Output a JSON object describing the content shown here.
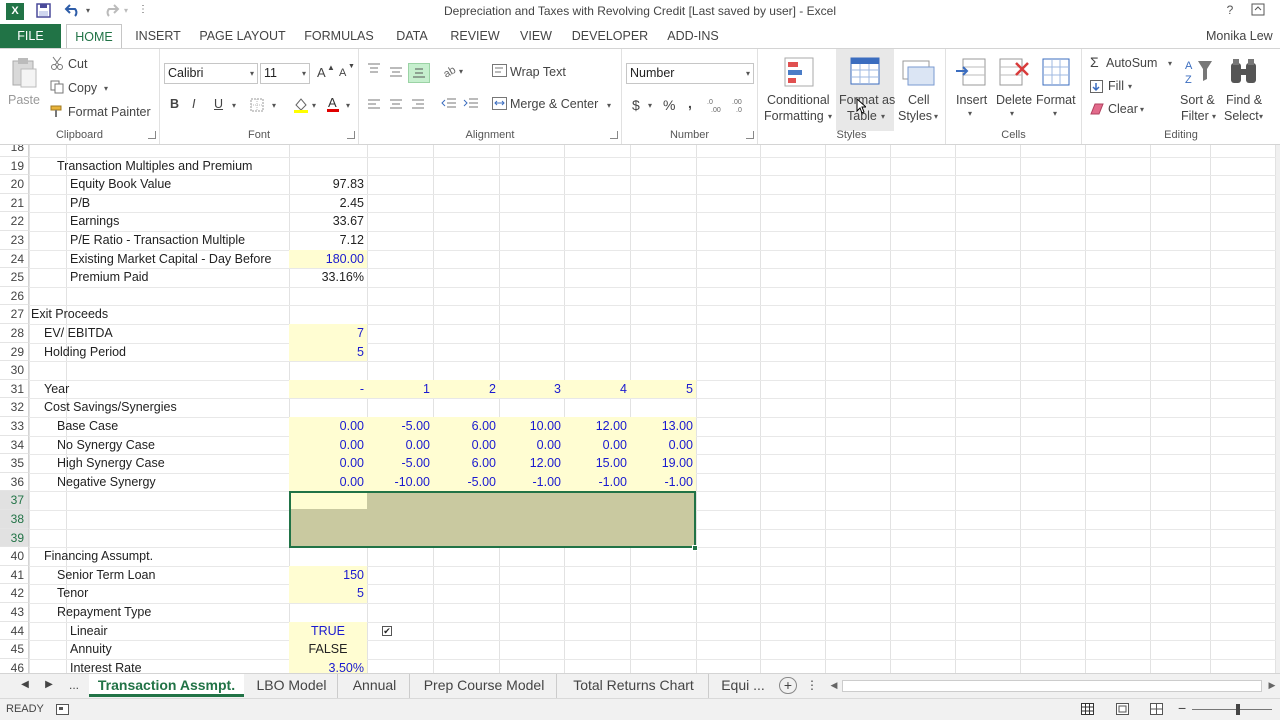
{
  "window": {
    "title": "Depreciation and Taxes with Revolving Credit [Last saved by user] - Excel",
    "help": "?",
    "user": "Monika Lew"
  },
  "ribbon_tabs": [
    "FILE",
    "HOME",
    "INSERT",
    "PAGE LAYOUT",
    "FORMULAS",
    "DATA",
    "REVIEW",
    "VIEW",
    "DEVELOPER",
    "ADD-INS"
  ],
  "clipboard": {
    "paste": "Paste",
    "cut": "Cut",
    "copy": "Copy",
    "format_painter": "Format Painter",
    "label": "Clipboard"
  },
  "font": {
    "name": "Calibri",
    "size": "11",
    "label": "Font",
    "bold": "B",
    "italic": "I",
    "underline": "U",
    "grow": "A",
    "shrink": "A"
  },
  "alignment": {
    "wrap": "Wrap Text",
    "merge": "Merge & Center",
    "label": "Alignment"
  },
  "number": {
    "format": "Number",
    "currency": "$",
    "percent": "%",
    "comma": ",",
    "label": "Number"
  },
  "styles": {
    "conditional_1": "Conditional",
    "conditional_2": "Formatting",
    "table_1": "Format as",
    "table_2": "Table",
    "cell_1": "Cell",
    "cell_2": "Styles",
    "label": "Styles"
  },
  "cells": {
    "insert": "Insert",
    "delete": "Delete",
    "format": "Format",
    "label": "Cells"
  },
  "editing": {
    "autosum": "AutoSum",
    "fill": "Fill",
    "clear": "Clear",
    "sort_1": "Sort &",
    "sort_2": "Filter",
    "find_1": "Find &",
    "find_2": "Select",
    "label": "Editing"
  },
  "rows": [
    {
      "n": "18",
      "a": "",
      "b": "",
      "c": "",
      "v": [
        "",
        "",
        "",
        "",
        "",
        ""
      ]
    },
    {
      "n": "19",
      "a": "",
      "b": "",
      "c": "Transaction Multiples and Premium",
      "v": [
        "",
        "",
        "",
        "",
        "",
        ""
      ]
    },
    {
      "n": "20",
      "a": "",
      "b": "",
      "c": "",
      "d": "Equity Book Value",
      "v": [
        "97.83",
        "",
        "",
        "",
        "",
        ""
      ]
    },
    {
      "n": "21",
      "d": "P/B",
      "v": [
        "2.45",
        "",
        "",
        "",
        "",
        ""
      ]
    },
    {
      "n": "22",
      "d": "Earnings",
      "v": [
        "33.67",
        "",
        "",
        "",
        "",
        ""
      ]
    },
    {
      "n": "23",
      "d": "P/E Ratio - Transaction Multiple",
      "v": [
        "7.12",
        "",
        "",
        "",
        "",
        ""
      ]
    },
    {
      "n": "24",
      "d": "Existing Market Capital - Day Before",
      "v": [
        "180.00",
        "",
        "",
        "",
        "",
        ""
      ]
    },
    {
      "n": "25",
      "d": "Premium Paid",
      "v": [
        "33.16%",
        "",
        "",
        "",
        "",
        ""
      ]
    },
    {
      "n": "26",
      "v": [
        "",
        "",
        "",
        "",
        "",
        ""
      ]
    },
    {
      "n": "27",
      "a": "Exit Proceeds",
      "v": [
        "",
        "",
        "",
        "",
        "",
        ""
      ]
    },
    {
      "n": "28",
      "b": "EV/ EBITDA",
      "v": [
        "7",
        "",
        "",
        "",
        "",
        ""
      ]
    },
    {
      "n": "29",
      "b": "Holding Period",
      "v": [
        "5",
        "",
        "",
        "",
        "",
        ""
      ]
    },
    {
      "n": "30",
      "v": [
        "",
        "",
        "",
        "",
        "",
        ""
      ]
    },
    {
      "n": "31",
      "b": "Year",
      "v": [
        "-",
        "1",
        "2",
        "3",
        "4",
        "5"
      ]
    },
    {
      "n": "32",
      "b": "Cost Savings/Synergies",
      "v": [
        "",
        "",
        "",
        "",
        "",
        ""
      ]
    },
    {
      "n": "33",
      "c": "Base Case",
      "v": [
        "0.00",
        "-5.00",
        "6.00",
        "10.00",
        "12.00",
        "13.00"
      ]
    },
    {
      "n": "34",
      "c": "No Synergy Case",
      "v": [
        "0.00",
        "0.00",
        "0.00",
        "0.00",
        "0.00",
        "0.00"
      ]
    },
    {
      "n": "35",
      "c": "High Synergy Case",
      "v": [
        "0.00",
        "-5.00",
        "6.00",
        "12.00",
        "15.00",
        "19.00"
      ]
    },
    {
      "n": "36",
      "c": "Negative Synergy",
      "v": [
        "0.00",
        "-10.00",
        "-5.00",
        "-1.00",
        "-1.00",
        "-1.00"
      ]
    },
    {
      "n": "37",
      "v": [
        "",
        "",
        "",
        "",
        "",
        ""
      ]
    },
    {
      "n": "38",
      "v": [
        "",
        "",
        "",
        "",
        "",
        ""
      ]
    },
    {
      "n": "39",
      "v": [
        "",
        "",
        "",
        "",
        "",
        ""
      ]
    },
    {
      "n": "40",
      "b": "Financing Assumpt.",
      "v": [
        "",
        "",
        "",
        "",
        "",
        ""
      ]
    },
    {
      "n": "41",
      "c": "Senior Term Loan",
      "v": [
        "150",
        "",
        "",
        "",
        "",
        ""
      ]
    },
    {
      "n": "42",
      "c": "Tenor",
      "v": [
        "5",
        "",
        "",
        "",
        "",
        ""
      ]
    },
    {
      "n": "43",
      "c": "Repayment Type",
      "v": [
        "",
        "",
        "",
        "",
        "",
        ""
      ]
    },
    {
      "n": "44",
      "d": "Lineair",
      "v": [
        "TRUE",
        "",
        "",
        "",
        "",
        ""
      ],
      "check": "✔"
    },
    {
      "n": "45",
      "d": "Annuity",
      "v": [
        "FALSE",
        "",
        "",
        "",
        "",
        ""
      ]
    },
    {
      "n": "46",
      "d": "Interest Rate",
      "v": [
        "3.50%",
        "",
        "",
        "",
        "",
        ""
      ]
    }
  ],
  "sheet_tabs": [
    "Transaction Assmpt.",
    "LBO Model",
    "Annual",
    "Prep Course Model",
    "Total Returns Chart",
    "Equi ..."
  ],
  "sheet_nav": {
    "ellipsis": "...",
    "add": "+"
  },
  "status": {
    "ready": "READY"
  }
}
